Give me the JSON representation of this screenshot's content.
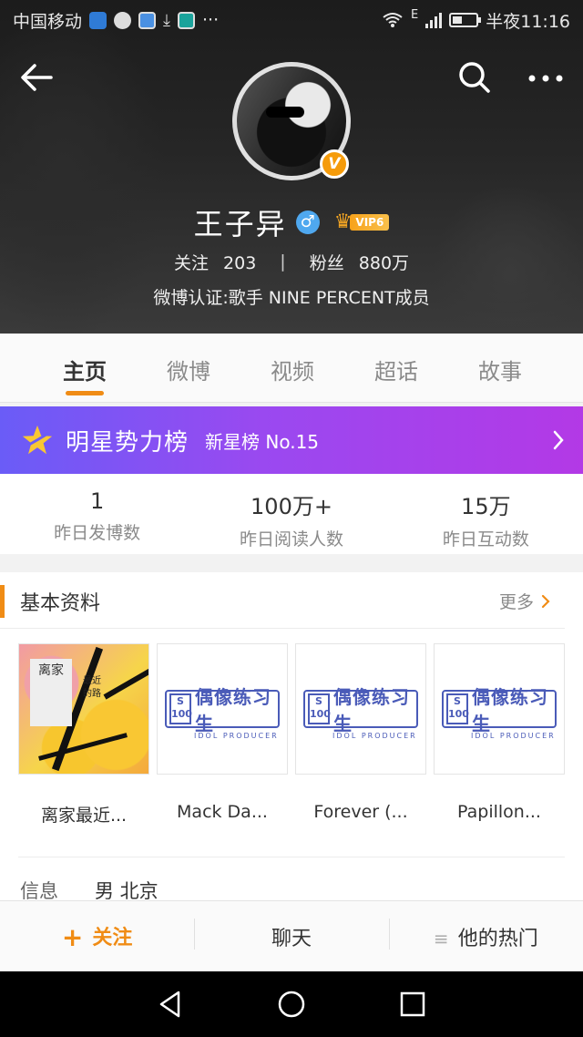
{
  "status_bar": {
    "carrier": "中国移动",
    "more": "···",
    "network": "E",
    "time": "半夜11:16"
  },
  "profile": {
    "name": "王子异",
    "gender_icon": "male-icon",
    "vip_label": "VIP6",
    "following_label": "关注",
    "following_count": "203",
    "followers_label": "粉丝",
    "followers_count": "880万",
    "verification": "微博认证:歌手 NINE PERCENT成员"
  },
  "tabs": [
    {
      "label": "主页",
      "active": true
    },
    {
      "label": "微博",
      "active": false
    },
    {
      "label": "视频",
      "active": false
    },
    {
      "label": "超话",
      "active": false
    },
    {
      "label": "故事",
      "active": false
    }
  ],
  "star_banner": {
    "title": "明星势力榜",
    "rank": "新星榜 No.15"
  },
  "metrics": [
    {
      "value": "1",
      "label": "昨日发博数"
    },
    {
      "value": "100万+",
      "label": "昨日阅读人数"
    },
    {
      "value": "15万",
      "label": "昨日互动数"
    }
  ],
  "basic_info": {
    "title": "基本资料",
    "more": "更多",
    "music": [
      {
        "name": "离家最近...",
        "cover": "album-cover",
        "cover_title": "离家",
        "cover_lines": [
          "最近",
          "的路"
        ]
      },
      {
        "name": "Mack Da...",
        "cover": "idol-producer-logo"
      },
      {
        "name": "Forever (...",
        "cover": "idol-producer-logo"
      },
      {
        "name": "Papillon...",
        "cover": "idol-producer-logo"
      }
    ],
    "idol_logo": {
      "box": "S 100",
      "text": "偶像练习生",
      "sub": "IDOL PRODUCER"
    },
    "info_label": "信息",
    "info_value": "男 北京"
  },
  "action_bar": {
    "follow": "关注",
    "chat": "聊天",
    "hot": "他的热门"
  },
  "colors": {
    "accent": "#f08c15",
    "banner_start": "#6a5cf7",
    "banner_end": "#b339e6",
    "vip": "#f7a21b"
  }
}
